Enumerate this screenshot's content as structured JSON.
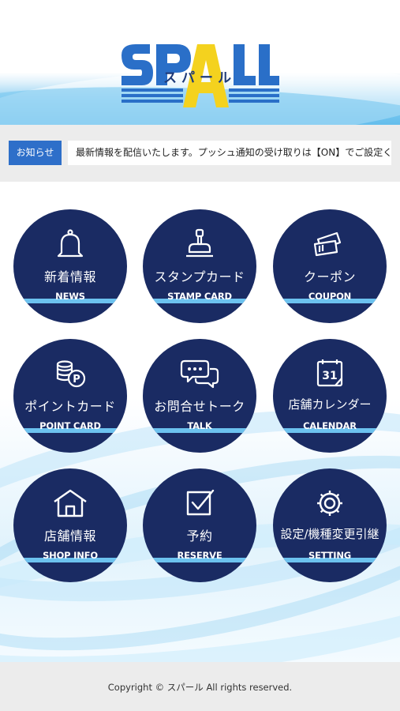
{
  "header": {
    "logo_en": "SPALL",
    "logo_jp": "スパール"
  },
  "news": {
    "tag": "お知らせ",
    "text": "最新情報を配信いたします。プッシュ通知の受け取りは【ON】でご設定ください。"
  },
  "menu": [
    {
      "label": "新着情報",
      "en": "NEWS",
      "icon": "bell-icon"
    },
    {
      "label": "スタンプカード",
      "en": "STAMP CARD",
      "icon": "stamp-icon"
    },
    {
      "label": "クーポン",
      "en": "COUPON",
      "icon": "coupon-icon"
    },
    {
      "label": "ポイントカード",
      "en": "POINT CARD",
      "icon": "coins-icon"
    },
    {
      "label": "お問合せトーク",
      "en": "TALK",
      "icon": "chat-bubbles-icon"
    },
    {
      "label": "店舗カレンダー",
      "en": "CALENDAR",
      "icon": "calendar-icon",
      "calendar_day": "31"
    },
    {
      "label": "店舗情報",
      "en": "SHOP INFO",
      "icon": "house-icon"
    },
    {
      "label": "予約",
      "en": "RESERVE",
      "icon": "checkbox-icon"
    },
    {
      "label": "設定/機種変更引継",
      "en": "SETTING",
      "icon": "gear-icon"
    }
  ],
  "footer": {
    "copyright": "Copyright © スパール All rights reserved."
  },
  "colors": {
    "tile": "#1a2b63",
    "band": "#6cc2ef",
    "news_tag": "#2e6fc9",
    "logo_blue": "#2a6fc8",
    "logo_yellow": "#f4d21e"
  }
}
